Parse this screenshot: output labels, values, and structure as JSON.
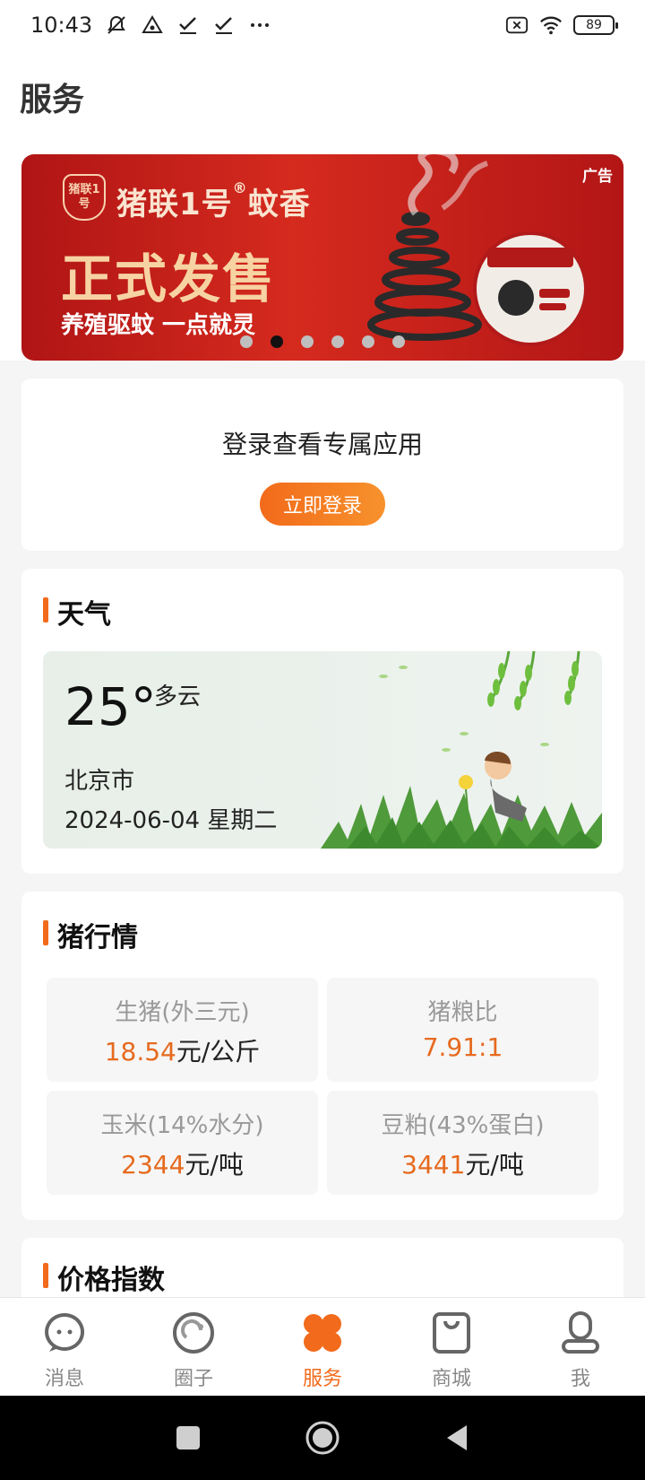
{
  "status_bar": {
    "time": "10:43",
    "left_icons": [
      "mute-vibrate-icon",
      "notification-icon",
      "check-icon",
      "check-icon",
      "more-dots-icon"
    ],
    "right_icons": [
      "no-sim-icon",
      "wifi-icon"
    ],
    "battery": "89"
  },
  "header": {
    "title": "服务"
  },
  "banner": {
    "ad_label": "广告",
    "brand_badge": "猪联1号",
    "brand_title": "猪联1号",
    "brand_product": "蚊香",
    "headline": "正式发售",
    "subline": "养殖驱蚊 一点就灵",
    "slide_count": 6,
    "active_slide": 2
  },
  "login_card": {
    "text": "登录查看专属应用",
    "button": "立即登录"
  },
  "weather": {
    "section_title": "天气",
    "temperature": "25°",
    "condition": "多云",
    "city": "北京市",
    "date": "2024-06-04  星期二"
  },
  "pig_market": {
    "section_title": "猪行情",
    "items": [
      {
        "label": "生猪(外三元)",
        "value": "18.54",
        "unit": "元/公斤"
      },
      {
        "label": "猪粮比",
        "value": "7.91:1",
        "unit": ""
      },
      {
        "label": "玉米(14%水分)",
        "value": "2344",
        "unit": "元/吨"
      },
      {
        "label": "豆粕(43%蛋白)",
        "value": "3441",
        "unit": "元/吨"
      }
    ]
  },
  "price_index": {
    "section_title": "价格指数"
  },
  "bottom_nav": {
    "items": [
      {
        "label": "消息",
        "icon": "chat-bubble-icon"
      },
      {
        "label": "圈子",
        "icon": "circle-refresh-icon"
      },
      {
        "label": "服务",
        "icon": "four-petal-icon"
      },
      {
        "label": "商城",
        "icon": "shopping-bag-icon"
      },
      {
        "label": "我",
        "icon": "person-icon"
      }
    ],
    "active_index": 2
  },
  "colors": {
    "accent": "#f26a1b",
    "banner_red": "#c91f1b"
  }
}
